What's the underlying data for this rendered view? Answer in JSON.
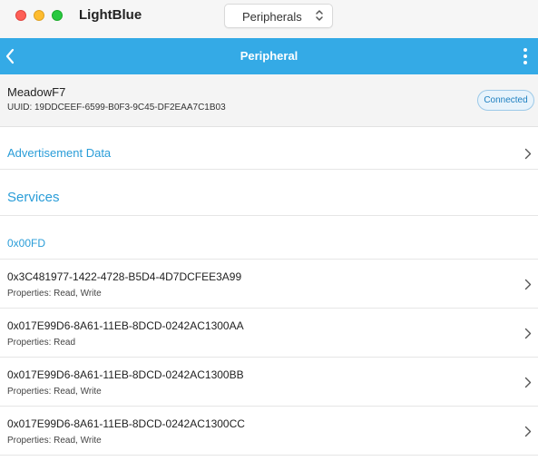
{
  "window": {
    "app_title": "LightBlue",
    "view_select": {
      "value": "Peripherals"
    }
  },
  "navbar": {
    "title": "Peripheral",
    "background": "#34aae6"
  },
  "peripheral": {
    "name": "MeadowF7",
    "uuid": "UUID: 19DDCEEF-6599-B0F3-9C45-DF2EAA7C1B03",
    "status": "Connected"
  },
  "advertisement": {
    "label": "Advertisement Data"
  },
  "services": {
    "section_title": "Services",
    "service_uuid": "0x00FD",
    "characteristics": [
      {
        "uuid": "0x3C481977-1422-4728-B5D4-4D7DCFEE3A99",
        "properties": "Properties: Read, Write"
      },
      {
        "uuid": "0x017E99D6-8A61-11EB-8DCD-0242AC1300AA",
        "properties": "Properties: Read"
      },
      {
        "uuid": "0x017E99D6-8A61-11EB-8DCD-0242AC1300BB",
        "properties": "Properties: Read, Write"
      },
      {
        "uuid": "0x017E99D6-8A61-11EB-8DCD-0242AC1300CC",
        "properties": "Properties: Read, Write"
      }
    ]
  },
  "colors": {
    "accent": "#2a9dd8",
    "badge_text": "#1d7fc0"
  }
}
